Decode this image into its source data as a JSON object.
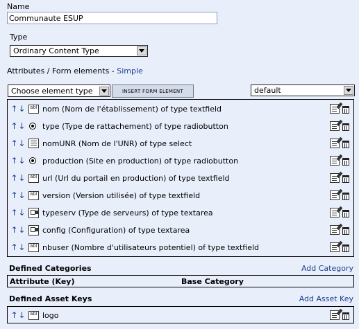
{
  "name_label": "Name",
  "name_value": "Communaute ESUP",
  "type_label": "Type",
  "type_value": "Ordinary Content Type",
  "attributes_label": "Attributes / Form elements -",
  "simple_link": "Simple",
  "element_select": "Choose element type",
  "insert_button": "Insert form element",
  "lang_select": "default",
  "attributes": [
    {
      "icon": "textfield-icon",
      "text": "nom (Nom de l'établissement) of type textfield"
    },
    {
      "icon": "radiobutton-icon",
      "text": "type (Type de rattachement) of type radiobutton"
    },
    {
      "icon": "select-icon",
      "text": "nomUNR (Nom de l'UNR) of type select"
    },
    {
      "icon": "radiobutton-icon",
      "text": "production (Site en production) of type radiobutton"
    },
    {
      "icon": "textfield-icon",
      "text": "url (Url du portail en production) of type textfield"
    },
    {
      "icon": "textfield-icon",
      "text": "version (Version utilisée) of type textfield"
    },
    {
      "icon": "textarea-icon",
      "text": "typeserv (Type de serveurs) of type textarea"
    },
    {
      "icon": "textarea-icon",
      "text": "config (Configuration) of type textarea"
    },
    {
      "icon": "textfield-icon",
      "text": "nbuser (Nombre d'utilisateurs potentiel) of type textfield"
    }
  ],
  "categories": {
    "title": "Defined Categories",
    "add_link": "Add Category",
    "col_key": "Attribute (Key)",
    "col_base": "Base Category"
  },
  "asset_keys": {
    "title": "Defined Asset Keys",
    "add_link": "Add Asset Key",
    "items": [
      "logo"
    ]
  },
  "colors": {
    "background": "#e9eefb",
    "link": "#1a3f8f"
  }
}
